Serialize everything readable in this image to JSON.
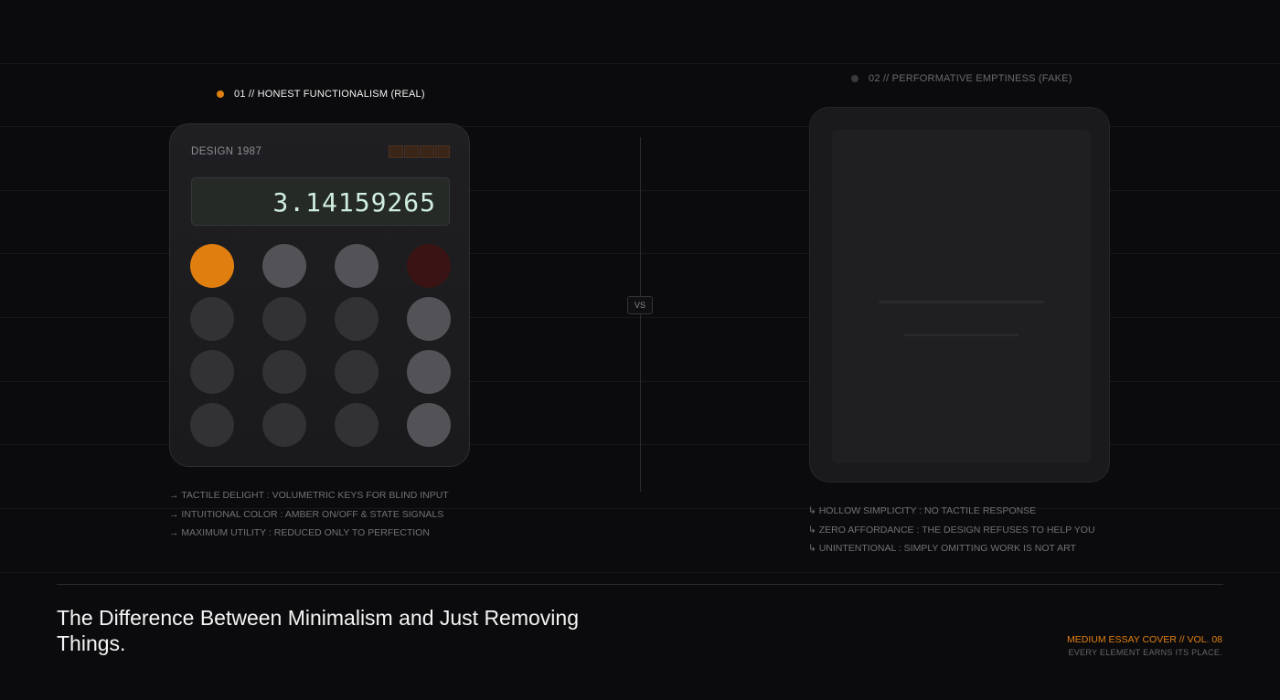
{
  "real": {
    "label": "01 // HONEST FUNCTIONALISM (REAL)",
    "brand": "DESIGN 1987",
    "display": "3.14159265",
    "notes": [
      "→ TACTILE DELIGHT : VOLUMETRIC KEYS FOR BLIND INPUT",
      "→ INTUITIONAL COLOR : AMBER ON/OFF & STATE SIGNALS",
      "→ MAXIMUM UTILITY : REDUCED ONLY TO PERFECTION"
    ]
  },
  "divider": {
    "label": "VS"
  },
  "fake": {
    "label": "02 // PERFORMATIVE EMPTINESS (FAKE)",
    "notes": [
      "↳ HOLLOW SIMPLICITY : NO TACTILE RESPONSE",
      "↳ ZERO AFFORDANCE : THE DESIGN REFUSES TO HELP YOU",
      "↳ UNINTENTIONAL : SIMPLY OMITTING WORK IS NOT ART"
    ]
  },
  "footer": {
    "title": "The Difference Between Minimalism and Just Removing Things.",
    "cover": "MEDIUM ESSAY COVER // VOL. 08",
    "tagline": "EVERY ELEMENT EARNS ITS PLACE."
  },
  "colors": {
    "accent": "#e07f10",
    "background": "#0b0b0d"
  }
}
